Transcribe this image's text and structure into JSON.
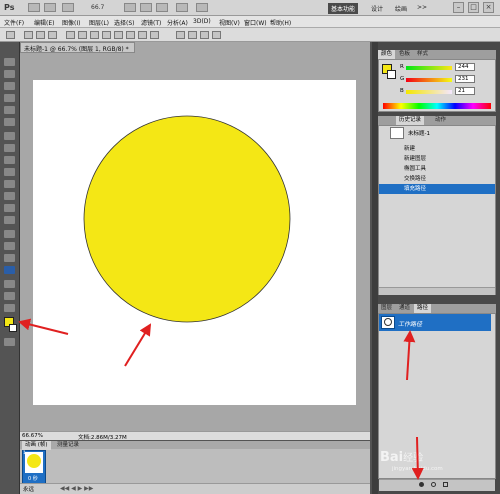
{
  "app": {
    "logo": "Ps",
    "zoom_display": "66.7"
  },
  "workspace": {
    "active": "基本功能",
    "items": [
      "设计",
      "绘画"
    ],
    "more": ">>"
  },
  "window_controls": [
    "–",
    "□",
    "×"
  ],
  "menu": [
    "文件(F)",
    "编辑(E)",
    "图像(I)",
    "图层(L)",
    "选择(S)",
    "滤镜(T)",
    "分析(A)",
    "3D(D)",
    "视图(V)",
    "窗口(W)",
    "帮助(H)"
  ],
  "document": {
    "tab_title": "未标题-1 @ 66.7% (图层 1, RGB/8) *",
    "zoom": "66.67%",
    "doc_info": "文档:2.86M/3.27M",
    "shape_color": "#f4e715"
  },
  "animation_panel": {
    "tabs": [
      "动画 (帧)",
      "测量记录"
    ],
    "frame_number": "1",
    "frame_delay": "0 秒",
    "loop": "永远"
  },
  "color_panel": {
    "tabs": [
      "颜色",
      "色板",
      "样式"
    ],
    "r_label": "R",
    "r_value": "244",
    "g_label": "G",
    "g_value": "231",
    "b_label": "B",
    "b_value": "21",
    "fg_color": "#f4e715"
  },
  "history_panel": {
    "tabs": [
      "历史记录",
      "动作"
    ],
    "snapshot": "未标题-1",
    "items": [
      "新建",
      "新建图层",
      "椭圆工具",
      "交换路径",
      "填充路径"
    ]
  },
  "paths_panel": {
    "tabs": [
      "图层",
      "通道",
      "路径"
    ],
    "item": "工作路径"
  },
  "watermark": {
    "brand": "Bai",
    "brand2": "经验",
    "sub": "jingyan.baidu.com"
  },
  "colors": {
    "accent": "#1f6fc4",
    "arrow": "#e02020",
    "fg": "#f4e715"
  }
}
